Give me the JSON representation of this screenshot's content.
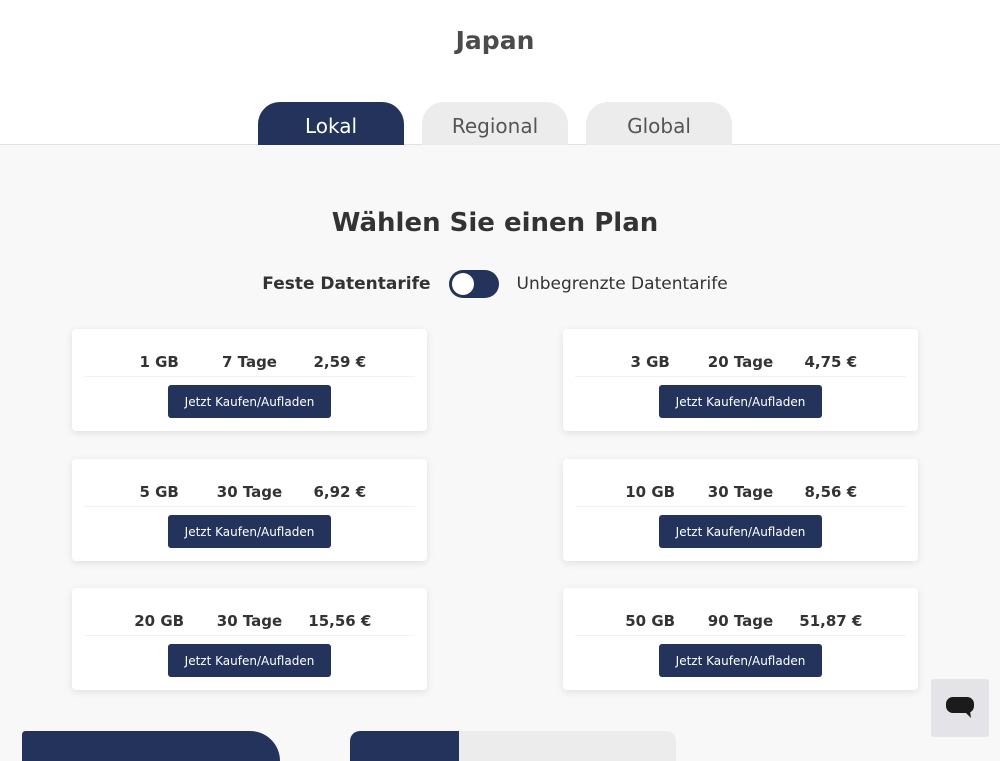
{
  "header": {
    "title": "Japan"
  },
  "tabs": [
    {
      "label": "Lokal",
      "active": true
    },
    {
      "label": "Regional",
      "active": false
    },
    {
      "label": "Global",
      "active": false
    }
  ],
  "main": {
    "heading": "Wählen Sie einen Plan",
    "toggle": {
      "left_label": "Feste Datentarife",
      "right_label": "Unbegrenzte Datentarife",
      "state": "off"
    }
  },
  "plans": [
    {
      "data": "1 GB",
      "days": "7 Tage",
      "price": "2,59 €",
      "button": "Jetzt Kaufen/Aufladen"
    },
    {
      "data": "3 GB",
      "days": "20 Tage",
      "price": "4,75 €",
      "button": "Jetzt Kaufen/Aufladen"
    },
    {
      "data": "5 GB",
      "days": "30 Tage",
      "price": "6,92 €",
      "button": "Jetzt Kaufen/Aufladen"
    },
    {
      "data": "10 GB",
      "days": "30 Tage",
      "price": "8,56 €",
      "button": "Jetzt Kaufen/Aufladen"
    },
    {
      "data": "20 GB",
      "days": "30 Tage",
      "price": "15,56 €",
      "button": "Jetzt Kaufen/Aufladen"
    },
    {
      "data": "50 GB",
      "days": "90 Tage",
      "price": "51,87 €",
      "button": "Jetzt Kaufen/Aufladen"
    }
  ],
  "chat": {
    "icon": "chat-bubble-icon"
  },
  "colors": {
    "accent": "#23335c",
    "background": "#f8f8f8",
    "tab_inactive": "#ececec"
  }
}
